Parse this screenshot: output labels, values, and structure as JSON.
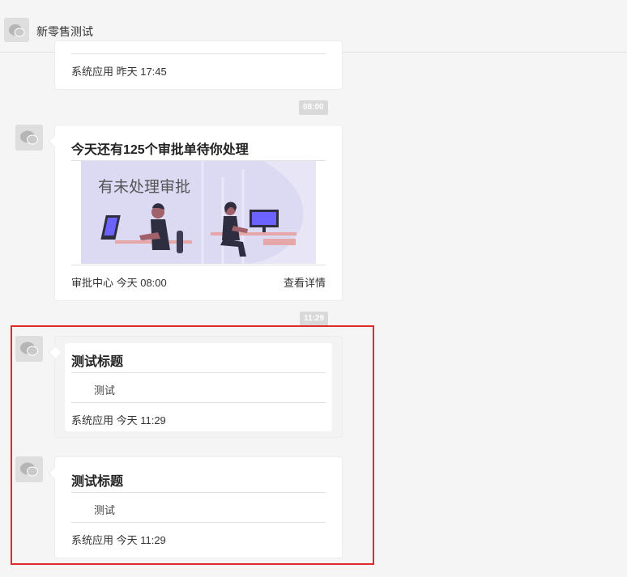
{
  "header": {
    "title": "新零售测试"
  },
  "messages": [
    {
      "footer": "系统应用 昨天 17:45"
    },
    {
      "time_badge": "08:00",
      "title": "今天还有125个审批单待你处理",
      "banner_text": "有未处理审批",
      "footer": "审批中心 今天 08:00",
      "link": "查看详情"
    },
    {
      "time_badge": "11:29",
      "title": "测试标题",
      "body": "测试",
      "footer": "系统应用 今天 11:29"
    },
    {
      "title": "测试标题",
      "body": "测试",
      "footer": "系统应用 今天 11:29"
    }
  ],
  "colors": {
    "highlight": "#e32a2a",
    "banner_bg": "#e8e6f6",
    "accent_purple": "#6c63ff"
  },
  "icons": {
    "avatar": "chat-bubble-icon",
    "maximize": "maximize-icon",
    "close": "close-icon"
  }
}
